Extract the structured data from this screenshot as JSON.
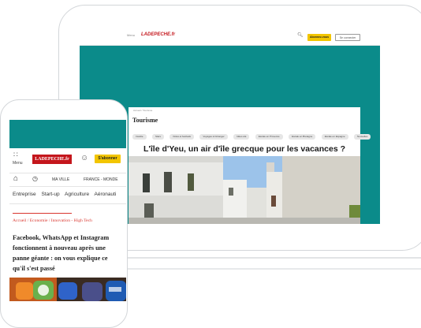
{
  "laptop": {
    "topbar": {
      "menu_label": "Menu",
      "logo_text": "LADEPECHE.fr",
      "subscribe_label": "Abonnez-vous",
      "login_label": "Se connecter"
    },
    "article": {
      "breadcrumb": "Accueil / Tourisme",
      "section_heading": "Tourisme",
      "tags": [
        "Insolite",
        "Stars",
        "Fêtes et festivals",
        "Voyages à l'étranger",
        "Idées été",
        "Escale en Provence",
        "Escale en Bretagne",
        "Escale en Espagne",
        "Nouvelles"
      ],
      "title": "L'île d'Yeu, un air d'île grecque pour les vacances ?"
    }
  },
  "phone": {
    "menu_label": "Menu",
    "logo_text": "LADEPECHE.fr",
    "subscribe_label": "S'abonner",
    "nav": {
      "ma_ville": "MA VILLE",
      "france_monde": "FRANCE - MONDE"
    },
    "categories": [
      "Entreprise",
      "Start-up",
      "Agriculture",
      "Aéronauti"
    ],
    "breadcrumb": "Accueil / Economie / Innovation - High Tech",
    "headline": "Facebook, WhatsApp et Instagram fonctionnent à nouveau après une panne géante : on vous explique ce qu'il s'est passé"
  },
  "colors": {
    "teal": "#0b8b8a",
    "brand_red": "#c4161c",
    "accent_yellow": "#f2c500",
    "link_red": "#d9362e"
  }
}
